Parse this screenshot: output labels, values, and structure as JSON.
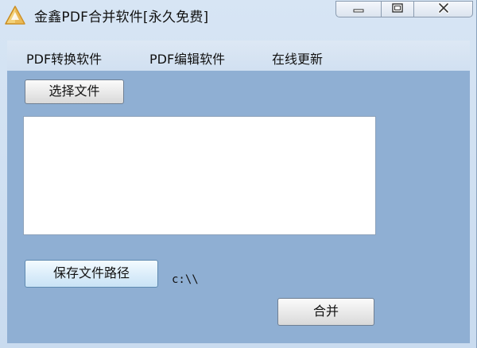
{
  "window": {
    "title": "金鑫PDF合并软件[永久免费]",
    "icon": "warning-triangle-icon"
  },
  "menu": {
    "items": [
      {
        "label": "PDF转换软件"
      },
      {
        "label": "PDF编辑软件"
      },
      {
        "label": "在线更新"
      }
    ]
  },
  "main": {
    "select_file_label": "选择文件",
    "save_path_label": "保存文件路径",
    "save_path_value": "c:\\\\",
    "merge_label": "合并"
  },
  "colors": {
    "client_background": "#8fafd3",
    "menubar_background": "#d1e0f1",
    "titlebar_background": "#d7e5f4"
  }
}
